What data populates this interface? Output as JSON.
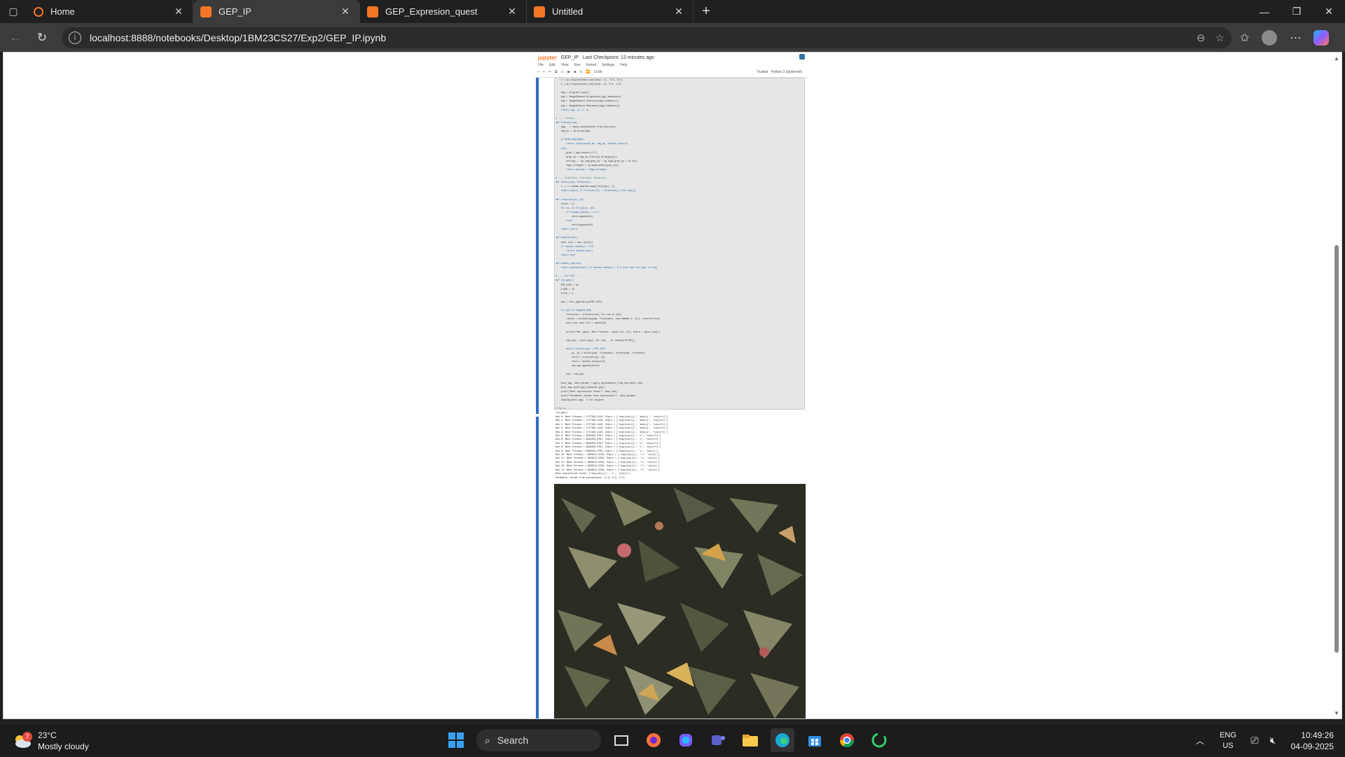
{
  "browser": {
    "tabs": [
      {
        "label": "Home",
        "active": false
      },
      {
        "label": "GEP_IP",
        "active": true
      },
      {
        "label": "GEP_Expresion_quest",
        "active": false
      },
      {
        "label": "Untitled",
        "active": false
      }
    ],
    "url": "localhost:8888/notebooks/Desktop/1BM23CS27/Exp2/GEP_IP.ipynb"
  },
  "notebook": {
    "logo": "jupyter",
    "name": "GEP_IP",
    "checkpoint": "Last Checkpoint: 13 minutes ago",
    "menu": [
      "File",
      "Edit",
      "View",
      "Run",
      "Kernel",
      "Settings",
      "Help"
    ],
    "cell_type": "Code",
    "kernel": "Python 3 (ipykernel)",
    "trusted_label": "Trusted"
  },
  "code_lines": [
    "    t = np.clip(evaluate_expr(expr, 1), -0.5, 0.5)",
    "    s = np.clip(evaluate_expr(expr, 2), 0.5, 1.5)",
    "",
    "    img = original.copy()",
    "    img = ImageEnhance.Brightness(img).enhance(b)",
    "    img = ImageEnhance.Contrast(img).enhance(c)",
    "    img = ImageEnhance.Sharpness(img).enhance(s)",
    "    return img, (b, c, s)",
    "",
    "# ---- Fitness ----",
    "def fitness(ind):",
    "    img, _ = apply_adjustments_from_expr(ind)",
    "    img_np = np.array(img)",
    "",
    "    if SSIM_AVAILABLE:",
    "        return ssim(target_np, img_np, channel_axis=2)",
    "    else:",
    "        gray = img.convert(\"L\")",
    "        gray_np = img_as_float(np.array(gray))",
    "        entropy = -np.sum(gray_np * np.log2(gray_np + 1e-10))",
    "        edge_strength = np.mean(sobel(gray_np))",
    "        return entropy + edge_strength",
    "",
    "# ---- Selection, Crossover, Mutation ----",
    "def select(pop, fitnesses):",
    "    i, j = random.sample(range(len(pop)), 2)",
    "    return pop[i] if fitnesses[i] > fitnesses[j] else pop[j]",
    "",
    "def crossover(p1, p2):",
    "    child = []",
    "    for e1, e2 in zip(p1, p2):",
    "        if random.random() < 0.5:",
    "            child.append(e1)",
    "        else:",
    "            child.append(e2)",
    "    return child",
    "",
    "def mutate(expr):",
    "    expr_list = expr.split()",
    "    if random.random() < 0.5:",
    "        return random_expr()",
    "    return expr",
    "",
    "def mutate_ind(ind):",
    "    return [mutate(expr) if random.random() < 0.3 else expr for expr in ind]",
    "",
    "# ---- Run GEP ----",
    "def run_gep():",
    "    POP_SIZE = 20",
    "    N_GEN = 15",
    "    ELITE = 2",
    "",
    "    pop = init_population(POP_SIZE)",
    "",
    "    for gen in range(N_GEN):",
    "        fitnesses = [fitness(ind) for ind in pop]",
    "        ranked = sorted(zip(pop, fitnesses), key=lambda x: x[1], reverse=True)",
    "        best_ind, best_fit = ranked[0]",
    "",
    "        print(f\"Gen {gen}: Best Fitness = {best_fit:.4f}, Exprs = {best_ind}\")",
    "",
    "        new_pop = [ind.copy() for ind, _ in ranked[:ELITE]]",
    "",
    "        while len(new_pop) < POP_SIZE:",
    "            p1, p2 = select(pop, fitnesses), select(pop, fitnesses)",
    "            child = crossover(p1, p2)",
    "            child = mutate_ind(child)",
    "            new_pop.append(child)",
    "",
    "        pop = new_pop",
    "",
    "    best_img, best_params = apply_adjustments_from_expr(best_ind)",
    "    best_img.save(\"gep_enhanced.jpg\")",
    "    print(\"Best expressions found:\", best_ind)",
    "    print(\"Parameter values from expressions:\", best_params)",
    "    display(best_img)  # for Jupyter",
    "",
    "# Run it",
    "run_gep()"
  ],
  "output_lines": [
    "Gen 0: Best Fitness = 7177348.1120, Exprs = ['exp(sin(x))', 'abs(x)', 'cos(x+1)']",
    "Gen 1: Best Fitness = 7177348.1120, Exprs = ['exp(sin(x))', 'abs(x)', 'cos(x+1)']",
    "Gen 2: Best Fitness = 7177348.1120, Exprs = ['exp(sin(x))', 'abs(x)', 'cos(x+1)']",
    "Gen 3: Best Fitness = 7177348.1120, Exprs = ['exp(sin(x))', 'abs(x)', 'cos(x+1)']",
    "Gen 4: Best Fitness = 7177348.1120, Exprs = ['exp(sin(x))', 'abs(x)', 'cos(x+1)']",
    "Gen 5: Best Fitness = 9826233.9797, Exprs = ['exp(sin(x))', 'x', 'cos(x+1)']",
    "Gen 6: Best Fitness = 9826233.9797, Exprs = ['exp(sin(x))', 'x', 'cos(x+1)']",
    "Gen 7: Best Fitness = 9826233.9797, Exprs = ['exp(sin(x))', 'x', 'cos(x+1)']",
    "Gen 8: Best Fitness = 9826233.9797, Exprs = ['exp(sin(x))', 'x', 'cos(x+1)']",
    "Gen 9: Best Fitness = 9826212.9784, Exprs = ['exp(sin(x))', 'x', 'sin(x)']",
    "Gen 10: Best Fitness = 9826212.9784, Exprs = ['exp(sin(x))', 'x', 'sin(x)']",
    "Gen 11: Best Fitness = 9826212.9784, Exprs = ['exp(sin(x))', 'x', 'sin(x)']",
    "Gen 12: Best Fitness = 9826212.9784, Exprs = ['exp(sin(x))', 'x', 'sin(x)']",
    "Gen 13: Best Fitness = 9826212.9784, Exprs = ['exp(sin(x))', 'x', 'sin(x)']",
    "Gen 14: Best Fitness = 9826212.9784, Exprs = ['exp(sin(x))', 'x', 'sin(x)']",
    "Best expressions found: ['exp(sin(x))', 'x', 'sin(x)']",
    "Parameter values from expressions: (1.5, 0.5, 0.5)"
  ],
  "taskbar": {
    "weather_temp": "23°C",
    "weather_desc": "Mostly cloudy",
    "weather_badge": "7",
    "search_label": "Search",
    "lang_line1": "ENG",
    "lang_line2": "US",
    "time": "10:49:26",
    "date": "04-09-2025"
  },
  "colors": {
    "jupyter_orange": "#f37726",
    "cell_selected_band": "#2e6dc4",
    "taskbar_bg": "#1c1c1c"
  }
}
